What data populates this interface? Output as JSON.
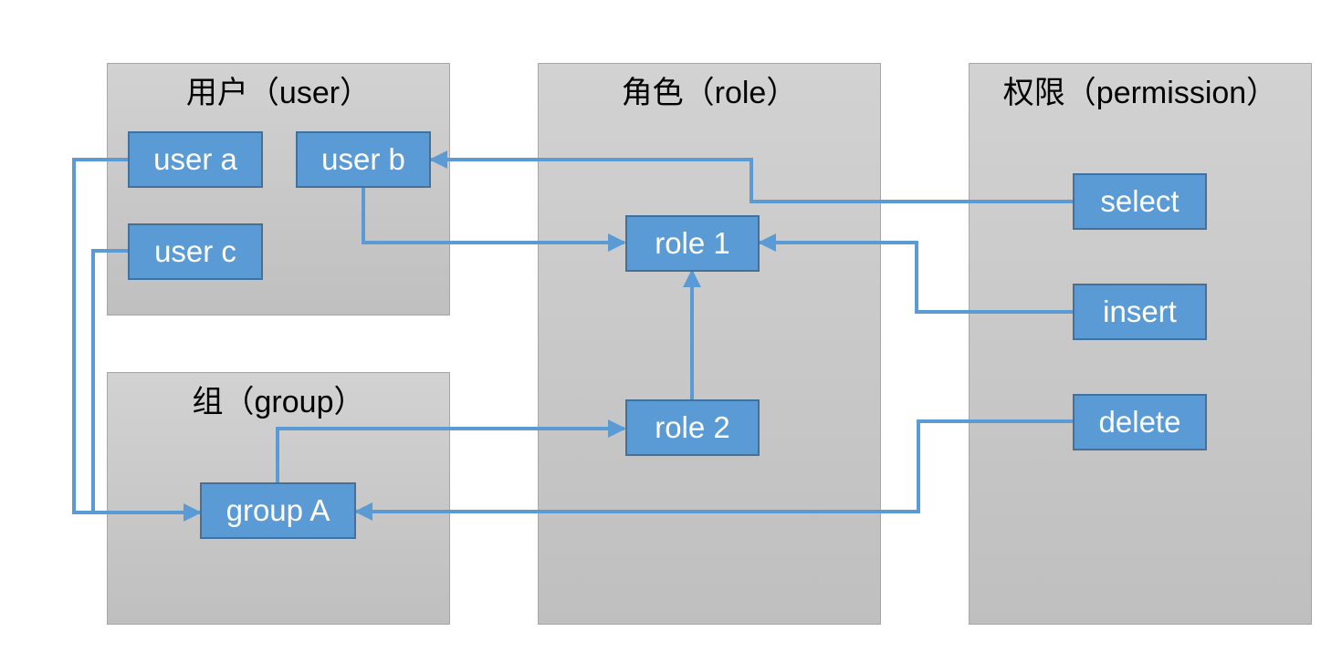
{
  "diagram": {
    "accent_color": "#5b9bd5",
    "node_border_color": "#41719c",
    "panels": {
      "user": "用户（user）",
      "group": "组（group）",
      "role": "角色（role）",
      "permission": "权限（permission）"
    },
    "nodes": {
      "user_a": "user a",
      "user_b": "user b",
      "user_c": "user c",
      "group_a": "group A",
      "role_1": "role 1",
      "role_2": "role 2",
      "select": "select",
      "insert": "insert",
      "delete": "delete"
    },
    "edges": [
      {
        "from": "user a",
        "to": "group A"
      },
      {
        "from": "user c",
        "to": "group A"
      },
      {
        "from": "user b",
        "to": "role 1"
      },
      {
        "from": "select",
        "to": "user b"
      },
      {
        "from": "insert",
        "to": "role 1"
      },
      {
        "from": "role 2",
        "to": "role 1"
      },
      {
        "from": "group A",
        "to": "role 2"
      },
      {
        "from": "delete",
        "to": "group A"
      }
    ]
  }
}
